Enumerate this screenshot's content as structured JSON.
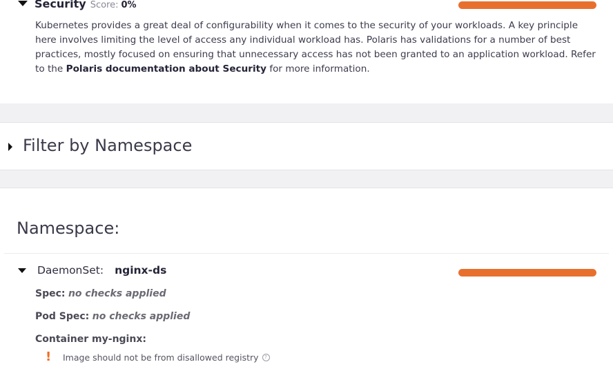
{
  "security": {
    "title": "Security",
    "score_label": "Score:",
    "score_value": "0%",
    "score_fraction": 0,
    "description_part1": "Kubernetes provides a great deal of configurability when it comes to the security of your workloads. A key principle here involves limiting the level of access any individual workload has. Polaris has validations for a number of best practices, mostly focused on ensuring that unnecessary access has not been granted to an application workload. Refer to the ",
    "doc_link": "Polaris documentation about Security",
    "description_part2": " for more information."
  },
  "filter": {
    "title": "Filter by Namespace"
  },
  "namespace": {
    "title": "Namespace:",
    "resource": {
      "kind": "DaemonSet:",
      "name": "nginx-ds",
      "score_fraction": 0,
      "spec_label": "Spec:",
      "spec_value": "no checks applied",
      "podspec_label": "Pod Spec:",
      "podspec_value": "no checks applied",
      "container_label": "Container my-nginx:",
      "warning_icon": "!",
      "warning_text": "Image should not be from disallowed registry",
      "help_icon": "?"
    }
  },
  "colors": {
    "bar_fail": "#e8702f",
    "bar_pass": "#8bd2dc",
    "warning": "#f26b21"
  }
}
